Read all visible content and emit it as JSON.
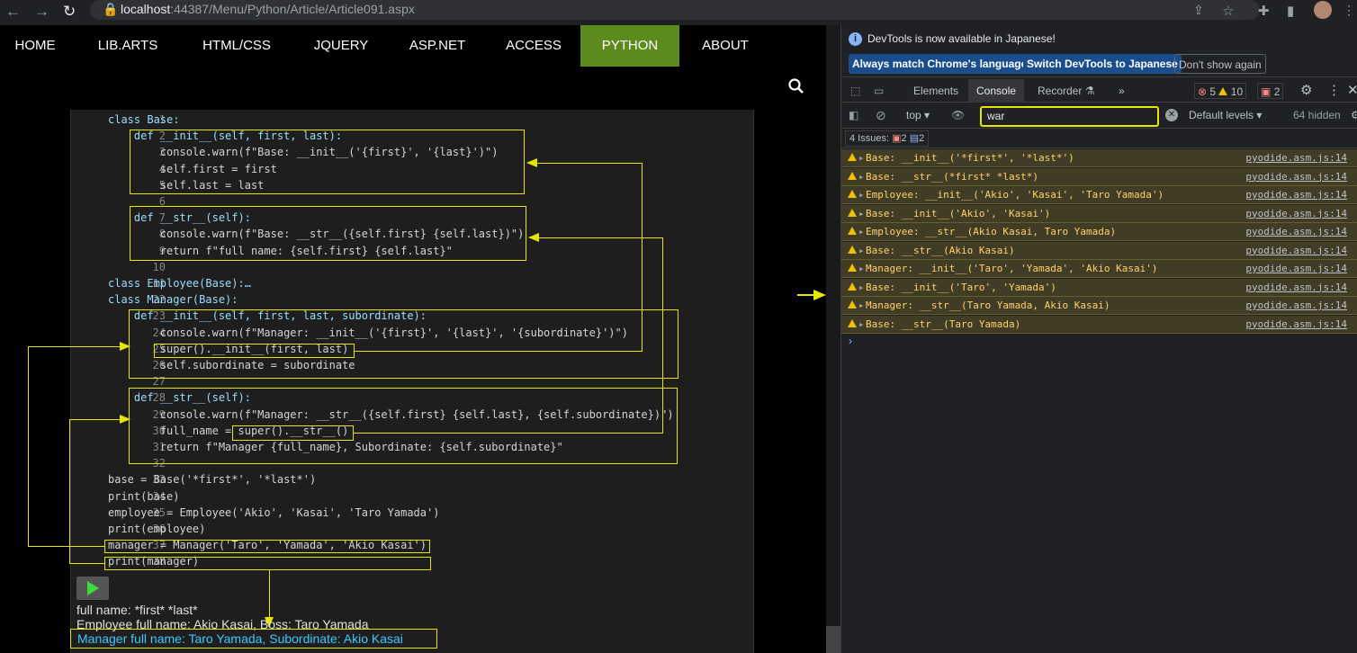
{
  "browser": {
    "url_host": "localhost",
    "url_rest": ":44387/Menu/Python/Article/Article091.aspx"
  },
  "nav": {
    "items": [
      "HOME",
      "LIB.ARTS",
      "HTML/CSS",
      "JQUERY",
      "ASP.NET",
      "ACCESS",
      "PYTHON",
      "ABOUT"
    ],
    "active": "PYTHON"
  },
  "code": {
    "lines": [
      {
        "n": "1",
        "t": "class Base:"
      },
      {
        "n": "2",
        "t": "    def __init__(self, first, last):"
      },
      {
        "n": "3",
        "t": "        console.warn(f\"Base: __init__('{first}', '{last}')\")"
      },
      {
        "n": "4",
        "t": "        self.first = first"
      },
      {
        "n": "5",
        "t": "        self.last = last"
      },
      {
        "n": "6",
        "t": ""
      },
      {
        "n": "7",
        "t": "    def __str__(self):"
      },
      {
        "n": "8",
        "t": "        console.warn(f\"Base: __str__({self.first} {self.last})\")"
      },
      {
        "n": "9",
        "t": "        return f\"full name: {self.first} {self.last}\""
      },
      {
        "n": "10",
        "t": ""
      },
      {
        "n": "11",
        "t": "class Employee(Base):…"
      },
      {
        "n": "22",
        "t": "class Manager(Base):"
      },
      {
        "n": "23",
        "t": "    def __init__(self, first, last, subordinate):"
      },
      {
        "n": "24",
        "t": "        console.warn(f\"Manager: __init__('{first}', '{last}', '{subordinate}')\")"
      },
      {
        "n": "25",
        "t": "        super().__init__(first, last)"
      },
      {
        "n": "26",
        "t": "        self.subordinate = subordinate"
      },
      {
        "n": "27",
        "t": ""
      },
      {
        "n": "28",
        "t": "    def __str__(self):"
      },
      {
        "n": "29",
        "t": "        console.warn(f\"Manager: __str__({self.first} {self.last}, {self.subordinate})\")"
      },
      {
        "n": "30",
        "t": "        full_name = super().__str__()"
      },
      {
        "n": "31",
        "t": "        return f\"Manager {full_name}, Subordinate: {self.subordinate}\""
      },
      {
        "n": "32",
        "t": ""
      },
      {
        "n": "33",
        "t": "base = Base('*first*', '*last*')"
      },
      {
        "n": "34",
        "t": "print(base)"
      },
      {
        "n": "35",
        "t": "employee = Employee('Akio', 'Kasai', 'Taro Yamada')"
      },
      {
        "n": "36",
        "t": "print(employee)"
      },
      {
        "n": "37",
        "t": "manager = Manager('Taro', 'Yamada', 'Akio Kasai')"
      },
      {
        "n": "38",
        "t": "print(manager)"
      }
    ]
  },
  "output": {
    "lines": [
      "full name: *first* *last*",
      "Employee full name: Akio Kasai, Boss: Taro Yamada"
    ],
    "highlight": "Manager full name: Taro Yamada, Subordinate: Akio Kasai"
  },
  "devtools": {
    "banner": {
      "text": "DevTools is now available in Japanese!",
      "btn1": "Always match Chrome's language",
      "btn2": "Switch DevTools to Japanese",
      "btn3": "Don't show again"
    },
    "tabs": [
      "Elements",
      "Console",
      "Recorder ⚗"
    ],
    "active_tab": "Console",
    "counts": {
      "errors": "5",
      "warnings": "10",
      "issues": "2"
    },
    "filter": {
      "context": "top",
      "value": "war",
      "levels": "Default levels",
      "hidden": "64 hidden"
    },
    "issues": {
      "label": "4 Issues:",
      "err": "2",
      "info": "2"
    },
    "messages": [
      {
        "text": "Base: __init__('*first*', '*last*')",
        "src": "pyodide.asm.js:14"
      },
      {
        "text": "Base: __str__(*first* *last*)",
        "src": "pyodide.asm.js:14"
      },
      {
        "text": "Employee: __init__('Akio', 'Kasai', 'Taro Yamada')",
        "src": "pyodide.asm.js:14"
      },
      {
        "text": "Base: __init__('Akio', 'Kasai')",
        "src": "pyodide.asm.js:14"
      },
      {
        "text": "Employee: __str__(Akio Kasai, Taro Yamada)",
        "src": "pyodide.asm.js:14"
      },
      {
        "text": "Base: __str__(Akio Kasai)",
        "src": "pyodide.asm.js:14"
      },
      {
        "text": "Manager: __init__('Taro', 'Yamada', 'Akio Kasai')",
        "src": "pyodide.asm.js:14"
      },
      {
        "text": "Base: __init__('Taro', 'Yamada')",
        "src": "pyodide.asm.js:14"
      },
      {
        "text": "Manager: __str__(Taro Yamada, Akio Kasai)",
        "src": "pyodide.asm.js:14"
      },
      {
        "text": "Base: __str__(Taro Yamada)",
        "src": "pyodide.asm.js:14"
      }
    ]
  }
}
